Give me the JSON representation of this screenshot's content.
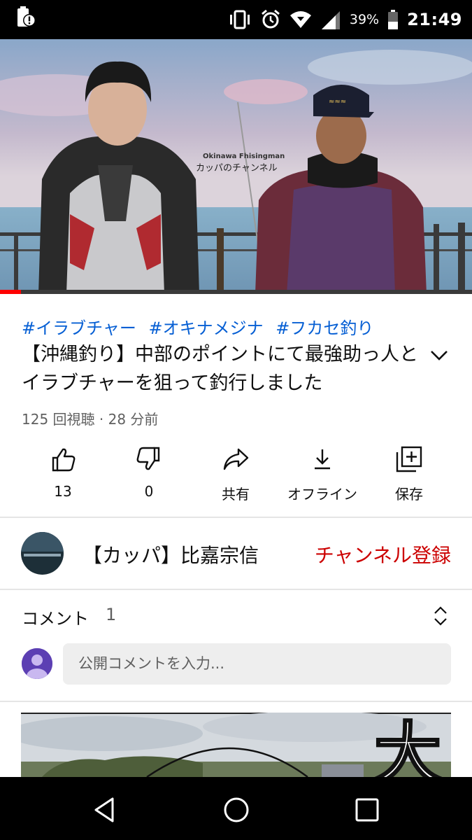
{
  "status_bar": {
    "battery_percent": "39%",
    "time": "21:49",
    "icons": [
      "battery-saver-alert-icon",
      "vibrate-icon",
      "alarm-icon",
      "wifi-icon",
      "signal-icon",
      "battery-icon"
    ]
  },
  "video": {
    "overlay_en": "Okinawa Fhisingman",
    "overlay_jp": "カッパのチャンネル",
    "progress_fraction": 0.045
  },
  "hashtags": [
    "#イラブチャー",
    "#オキナメジナ",
    "#フカセ釣り"
  ],
  "title": "【沖縄釣り】中部のポイントにて最強助っ人とイラブチャーを狙って釣行しました",
  "meta": "125 回視聴 · 28 分前",
  "actions": {
    "like": {
      "label": "13",
      "icon": "thumbs-up-icon"
    },
    "dislike": {
      "label": "0",
      "icon": "thumbs-down-icon"
    },
    "share": {
      "label": "共有",
      "icon": "share-icon"
    },
    "offline": {
      "label": "オフライン",
      "icon": "download-icon"
    },
    "save": {
      "label": "保存",
      "icon": "playlist-add-icon"
    }
  },
  "channel": {
    "name": "【カッパ】比嘉宗信",
    "subscribe_label": "チャンネル登録"
  },
  "comments": {
    "title": "コメント",
    "count": "1",
    "placeholder": "公開コメントを入力..."
  },
  "next_video": {
    "thumb_text": "大"
  },
  "colors": {
    "accent_red": "#ff0000",
    "subscribe_red": "#cc0000",
    "link_blue": "#065fd4",
    "my_avatar": "#5c3fb3"
  },
  "nav": {
    "icons": [
      "back-icon",
      "home-icon",
      "recents-icon"
    ]
  }
}
